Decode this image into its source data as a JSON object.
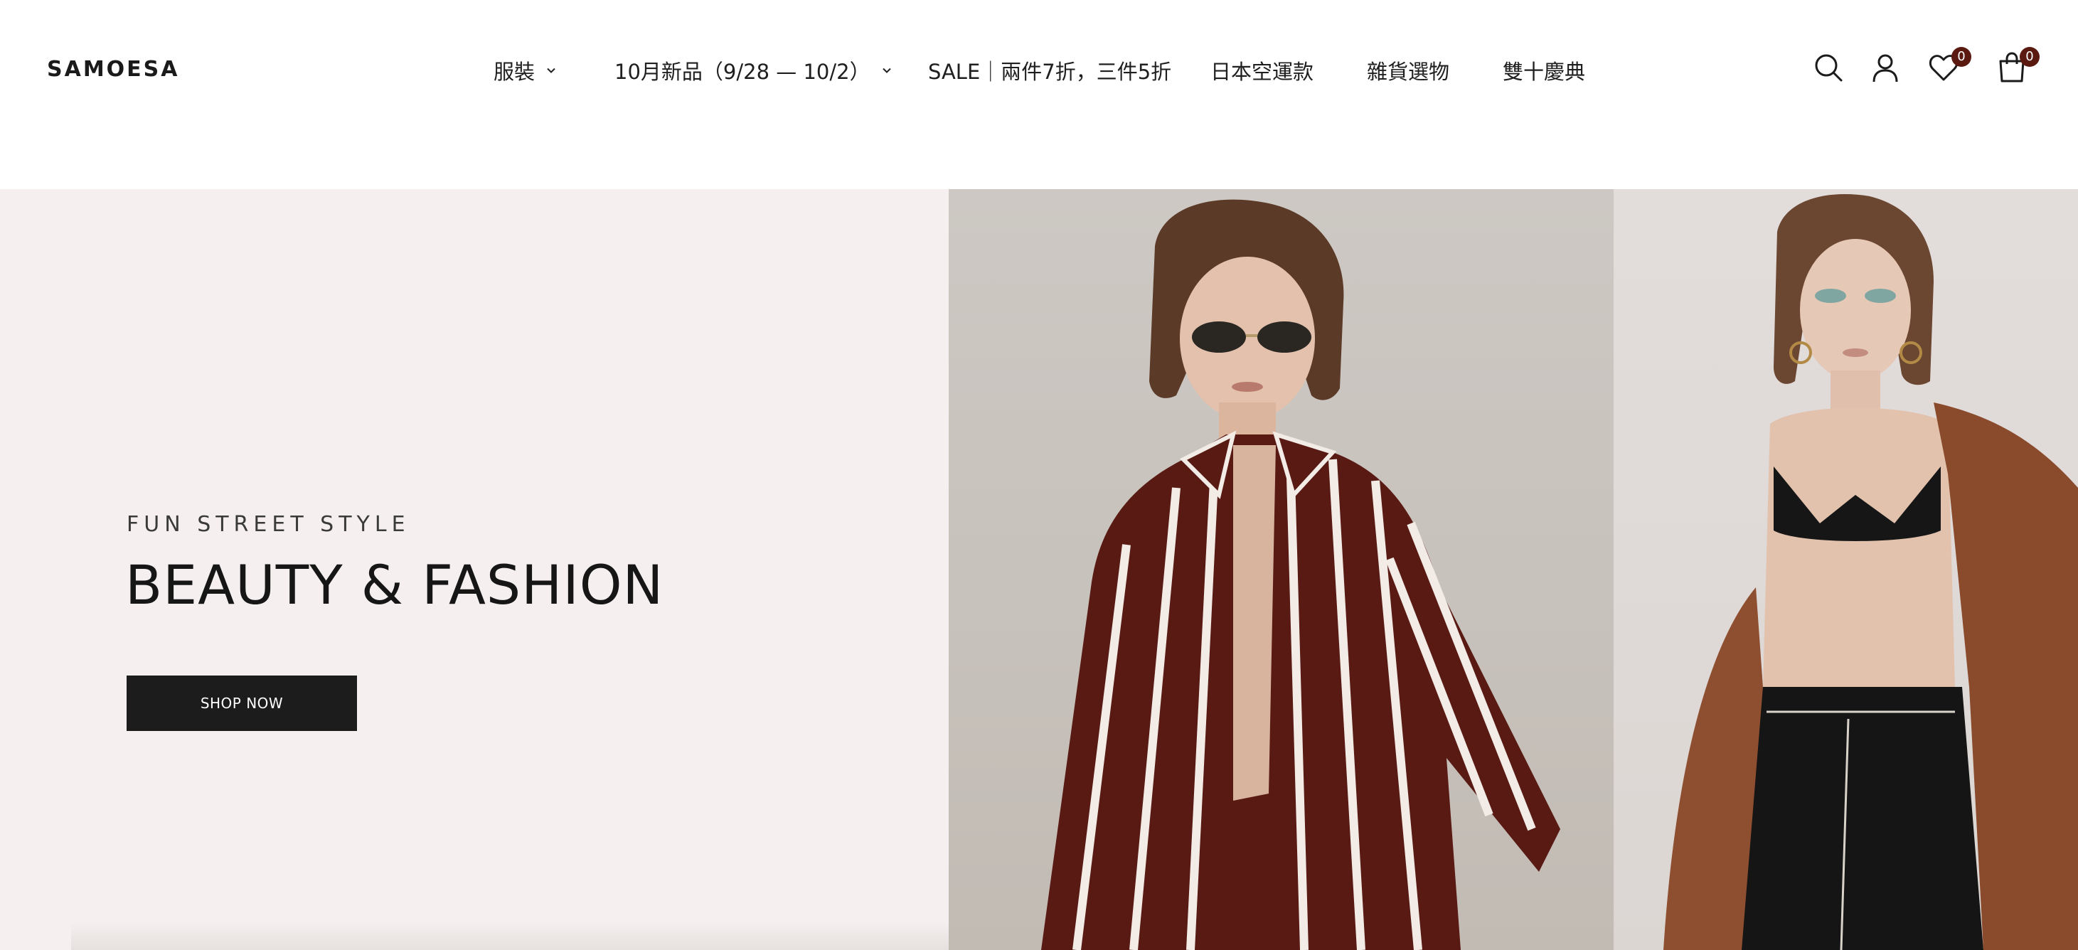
{
  "brand": {
    "logo_text": "SAMOESA"
  },
  "nav": {
    "items": [
      {
        "label": "服裝",
        "has_dropdown": true
      },
      {
        "label": "10月新品（9/28 — 10/2）",
        "has_dropdown": true
      },
      {
        "label": "SALE｜兩件7折，三件5折",
        "has_dropdown": false
      },
      {
        "label": "日本空運款",
        "has_dropdown": false
      },
      {
        "label": "雜貨選物",
        "has_dropdown": false
      },
      {
        "label": "雙十慶典",
        "has_dropdown": false
      }
    ]
  },
  "header_icons": {
    "search": {
      "icon": "search-icon"
    },
    "account": {
      "icon": "user-icon"
    },
    "wishlist": {
      "icon": "heart-icon",
      "count": "0"
    },
    "cart": {
      "icon": "bag-icon",
      "count": "0"
    }
  },
  "hero": {
    "subtitle": "FUN STREET STYLE",
    "title": "BEAUTY & FASHION",
    "cta_label": "SHOP NOW"
  },
  "colors": {
    "accent_badge": "#5a1a10",
    "hero_background": "#f5f0ef",
    "button_background": "#1c1c1c"
  }
}
